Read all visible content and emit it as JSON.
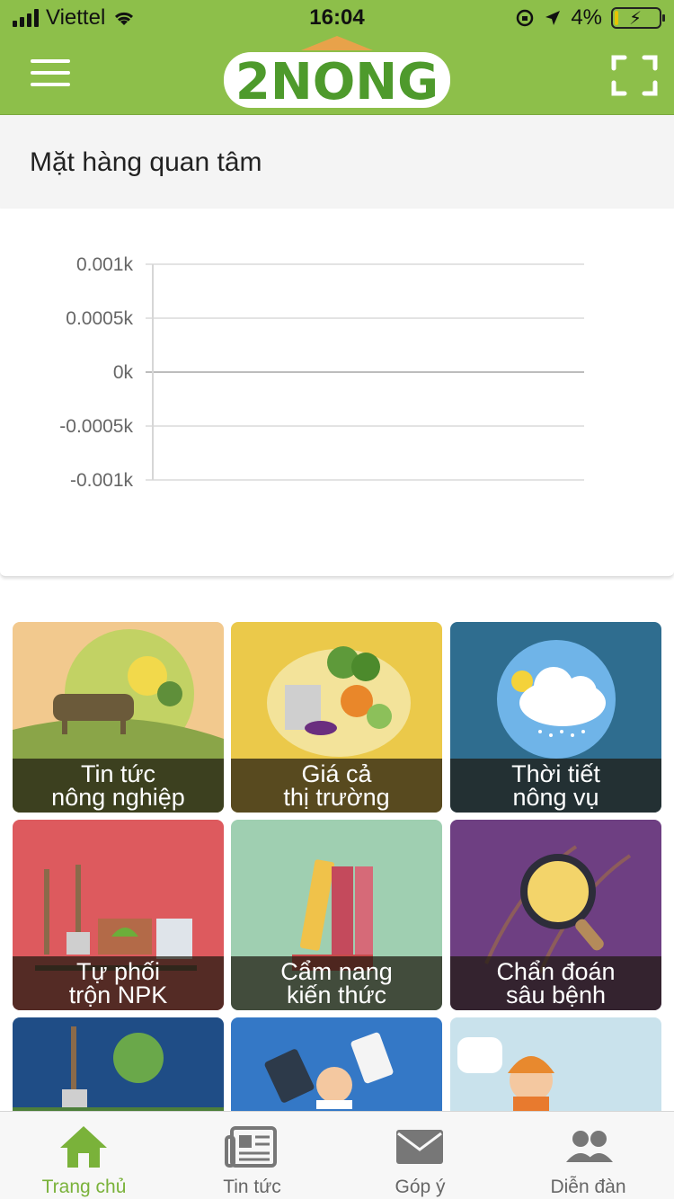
{
  "status_bar": {
    "carrier": "Viettel",
    "time": "16:04",
    "battery_percent": "4%"
  },
  "header": {
    "logo_text": "2NONG",
    "accent": "#8dbf4a"
  },
  "section": {
    "title": "Mặt hàng quan tâm"
  },
  "chart_data": {
    "type": "line",
    "title": "",
    "xlabel": "",
    "ylabel": "",
    "y_ticks": [
      "0.001k",
      "0.0005k",
      "0k",
      "-0.0005k",
      "-0.001k"
    ],
    "ylim": [
      -0.001,
      0.001
    ],
    "grid": true,
    "series": []
  },
  "tiles": [
    {
      "line1": "Tin tức",
      "line2": "nông nghiệp",
      "bg": "#f2c98e"
    },
    {
      "line1": "Giá cả",
      "line2": "thị trường",
      "bg": "#ebc94a"
    },
    {
      "line1": "Thời tiết",
      "line2": "nông vụ",
      "bg": "#2f6d8f"
    },
    {
      "line1": "Tự phối",
      "line2": "trộn NPK",
      "bg": "#dd5a5e"
    },
    {
      "line1": "Cẩm nang",
      "line2": "kiến thức",
      "bg": "#9fcfb1"
    },
    {
      "line1": "Chẩn đoán",
      "line2": "sâu bệnh",
      "bg": "#6e3f82"
    },
    {
      "line1": "",
      "line2": "",
      "bg": "#1f4d86"
    },
    {
      "line1": "",
      "line2": "",
      "bg": "#3478c6"
    },
    {
      "line1": "",
      "line2": "",
      "bg": "#c9e2ec"
    }
  ],
  "tabbar": {
    "items": [
      {
        "label": "Trang chủ",
        "icon": "home-icon",
        "active": true
      },
      {
        "label": "Tin tức",
        "icon": "newspaper-icon",
        "active": false
      },
      {
        "label": "Góp ý",
        "icon": "mail-icon",
        "active": false
      },
      {
        "label": "Diễn đàn",
        "icon": "people-icon",
        "active": false
      }
    ],
    "active_color": "#7ab23a"
  }
}
